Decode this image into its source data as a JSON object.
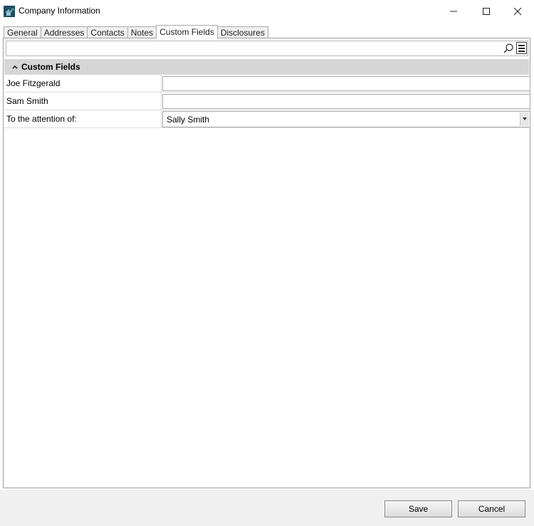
{
  "window": {
    "title": "Company Information",
    "icons": {
      "app": "house-icon",
      "minimize": "minimize-icon",
      "maximize": "maximize-icon",
      "close": "close-icon"
    }
  },
  "tabs": [
    {
      "label": "General",
      "active": false
    },
    {
      "label": "Addresses",
      "active": false
    },
    {
      "label": "Contacts",
      "active": false
    },
    {
      "label": "Notes",
      "active": false
    },
    {
      "label": "Custom Fields",
      "active": true
    },
    {
      "label": "Disclosures",
      "active": false
    }
  ],
  "search": {
    "value": "",
    "placeholder": ""
  },
  "section": {
    "title": "Custom Fields",
    "expanded": true
  },
  "fields": [
    {
      "label": "Joe Fitzgerald",
      "value": "",
      "type": "text"
    },
    {
      "label": "Sam Smith",
      "value": "",
      "type": "text"
    },
    {
      "label": "To the attention of:",
      "value": "Sally Smith",
      "type": "select"
    }
  ],
  "buttons": {
    "save": "Save",
    "cancel": "Cancel"
  },
  "colors": {
    "section_header": "#d6d6d6",
    "footer": "#f0f0f0",
    "border": "#9d9d9d"
  }
}
